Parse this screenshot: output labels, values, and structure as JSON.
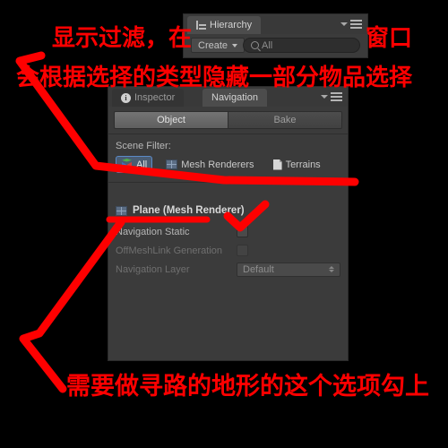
{
  "window": {
    "background_color": "#000000",
    "annotation_color": "#fe0000"
  },
  "hierarchy": {
    "tab_label": "Hierarchy",
    "tab_icon": "hierarchy-list-icon",
    "create_button": "Create",
    "create_caret": "▾",
    "search_placeholder": "All",
    "search_icon": "search-icon",
    "menu_icon": "panel-menu-icon"
  },
  "inspector": {
    "tabs": [
      {
        "label": "Inspector",
        "icon": "info-icon",
        "selected": false
      },
      {
        "label": "Navigation",
        "icon": "",
        "selected": true
      }
    ],
    "menu_icon": "panel-menu-icon",
    "mode_tabs": [
      {
        "label": "Object",
        "selected": true
      },
      {
        "label": "Bake",
        "selected": false
      }
    ],
    "scene_filter": {
      "title": "Scene Filter:",
      "options": [
        {
          "label": "All",
          "icon": "cube-icon",
          "selected": true
        },
        {
          "label": "Mesh Renderers",
          "icon": "mesh-renderer-icon",
          "selected": false
        },
        {
          "label": "Terrains",
          "icon": "terrain-icon",
          "selected": false
        }
      ]
    },
    "object": {
      "title": "Plane (Mesh Renderer)",
      "icon": "mesh-renderer-icon",
      "properties": [
        {
          "label": "Navigation Static",
          "type": "checkbox",
          "checked": false,
          "disabled": false
        },
        {
          "label": "OffMeshLink Generation",
          "type": "checkbox",
          "checked": false,
          "disabled": true
        },
        {
          "label": "Navigation Layer",
          "type": "dropdown",
          "value": "Default",
          "disabled": true
        }
      ]
    }
  },
  "annotations": {
    "top_line_1": "显示过滤，在",
    "top_line_1b": "窗口",
    "top_line_2": "会根据选择的类型隐藏一部分物品选择",
    "bottom_line": "需要做寻路的地形的这个选项勾上",
    "shapes": [
      {
        "name": "upper-pointer-polyline"
      },
      {
        "name": "lower-pointer-polyline"
      },
      {
        "name": "navigation-static-underline"
      },
      {
        "name": "checkmark"
      }
    ]
  }
}
